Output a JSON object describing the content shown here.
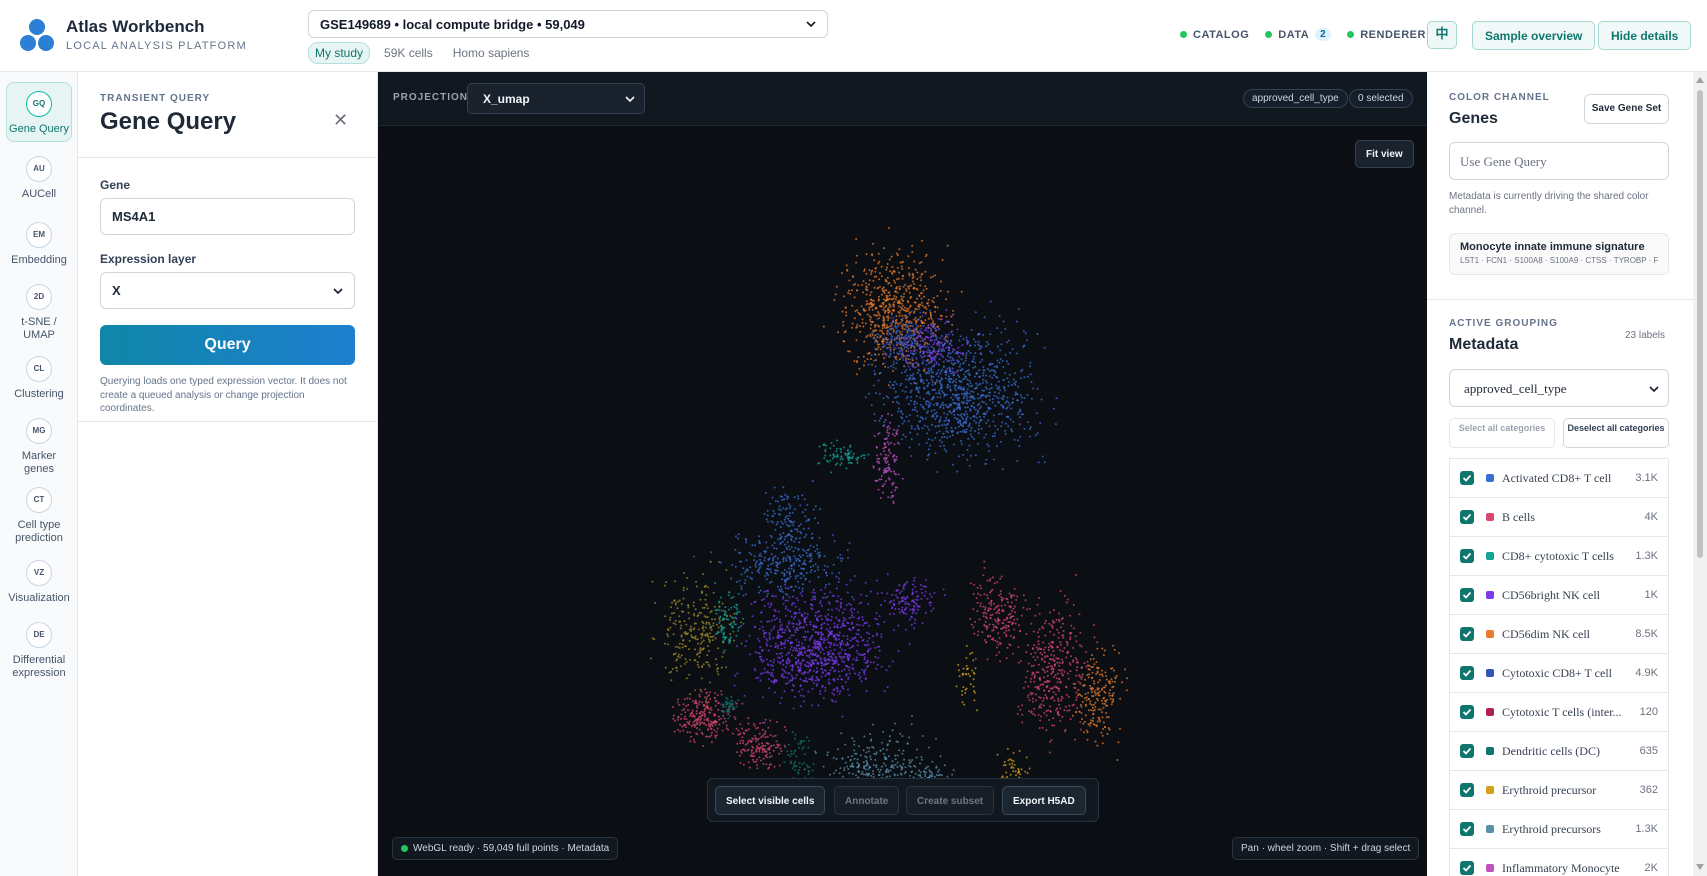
{
  "app": {
    "title": "Atlas Workbench",
    "subtitle": "LOCAL ANALYSIS PLATFORM"
  },
  "header": {
    "dataset": "GSE149689 • local compute bridge • 59,049",
    "chips": [
      "My study",
      "59K cells",
      "Homo sapiens"
    ],
    "status": [
      {
        "label": "CATALOG",
        "color": "#22c55e"
      },
      {
        "label": "DATA",
        "color": "#22c55e",
        "badge": "2"
      },
      {
        "label": "RENDERER",
        "color": "#22c55e"
      }
    ],
    "lang_label": "中",
    "sample_overview_label": "Sample overview",
    "hide_details_label": "Hide details"
  },
  "rail": [
    {
      "abbr": "GQ",
      "label": "Gene Query",
      "active": true
    },
    {
      "abbr": "AU",
      "label": "AUCell"
    },
    {
      "abbr": "EM",
      "label": "Embedding"
    },
    {
      "abbr": "2D",
      "label": "t-SNE / UMAP"
    },
    {
      "abbr": "CL",
      "label": "Clustering"
    },
    {
      "abbr": "MG",
      "label": "Marker genes"
    },
    {
      "abbr": "CT",
      "label": "Cell type prediction"
    },
    {
      "abbr": "VZ",
      "label": "Visualization"
    },
    {
      "abbr": "DE",
      "label": "Differential expression"
    }
  ],
  "query_panel": {
    "eyebrow": "TRANSIENT QUERY",
    "title": "Gene Query",
    "close_icon": "close-icon",
    "gene_label": "Gene",
    "gene_value": "MS4A1",
    "layer_label": "Expression layer",
    "layer_value": "X",
    "query_button": "Query",
    "note": "Querying loads one typed expression vector. It does not create a queued analysis or change projection coordinates."
  },
  "canvas": {
    "projection_label": "PROJECTION",
    "projection_value": "X_umap",
    "grouping_pill": "approved_cell_type",
    "selected_pill": "0 selected",
    "fit_view": "Fit view",
    "actions": [
      {
        "label": "Select visible cells",
        "enabled": true
      },
      {
        "label": "Annotate",
        "enabled": false
      },
      {
        "label": "Create subset",
        "enabled": false
      },
      {
        "label": "Export H5AD",
        "enabled": true
      }
    ],
    "status_left": "WebGL ready · 59,049 full points · Metadata",
    "status_right": "Pan · wheel zoom · Shift + drag select"
  },
  "right_panel": {
    "color_eyebrow": "COLOR CHANNEL",
    "color_title": "Genes",
    "save_gene_set": "Save Gene Set",
    "gene_query_placeholder": "Use Gene Query",
    "note": "Metadata is currently driving the shared color channel.",
    "signature_name": "Monocyte innate immune signature",
    "signature_genes": "LST1 · FCN1 · S100A8 · S100A9 · CTSS · TYROBP · F...",
    "grouping_eyebrow": "ACTIVE GROUPING",
    "grouping_title": "Metadata",
    "labels_count": "23 labels",
    "grouping_value": "approved_cell_type",
    "select_all": "Select all categories",
    "deselect_all": "Deselect all categories",
    "categories": [
      {
        "name": "Activated CD8+ T cell",
        "count": "3.1K",
        "color": "#3b6fd6",
        "checked": true
      },
      {
        "name": "B cells",
        "count": "4K",
        "color": "#d9466e",
        "checked": true
      },
      {
        "name": "CD8+ cytotoxic T cells",
        "count": "1.3K",
        "color": "#14a394",
        "checked": true
      },
      {
        "name": "CD56bright NK cell",
        "count": "1K",
        "color": "#7c3aed",
        "checked": true
      },
      {
        "name": "CD56dim NK cell",
        "count": "8.5K",
        "color": "#ea7a2a",
        "checked": true
      },
      {
        "name": "Cytotoxic CD8+ T cell",
        "count": "4.9K",
        "color": "#3653b8",
        "checked": true
      },
      {
        "name": "Cytotoxic T cells (inter...",
        "count": "120",
        "color": "#b0234d",
        "checked": true
      },
      {
        "name": "Dendritic cells (DC)",
        "count": "635",
        "color": "#0f766e",
        "checked": true
      },
      {
        "name": "Erythroid precursor",
        "count": "362",
        "color": "#d4a017",
        "checked": true
      },
      {
        "name": "Erythroid precursors",
        "count": "1.3K",
        "color": "#5b8fa8",
        "checked": true
      },
      {
        "name": "Inflammatory Monocyte",
        "count": "2K",
        "color": "#c04fc0",
        "checked": true
      }
    ]
  }
}
